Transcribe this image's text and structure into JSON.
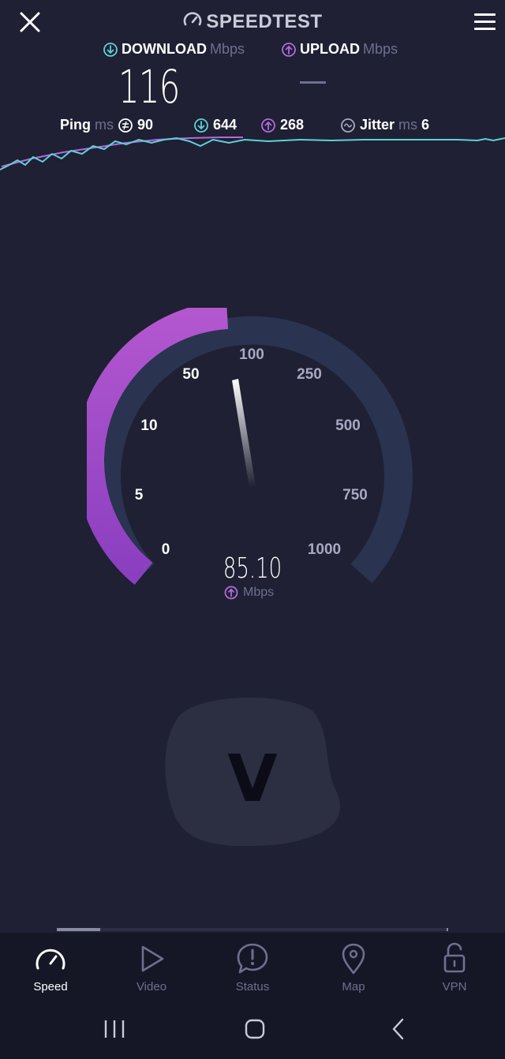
{
  "header": {
    "title": "SPEEDTEST"
  },
  "download": {
    "label": "DOWNLOAD",
    "unit": "Mbps",
    "value": "116"
  },
  "upload": {
    "label": "UPLOAD",
    "unit": "Mbps",
    "value": "—"
  },
  "stats": {
    "ping_label": "Ping",
    "ping_unit": "ms",
    "ping_value": "90",
    "download_latency": "644",
    "upload_latency": "268",
    "jitter_label": "Jitter",
    "jitter_unit": "ms",
    "jitter_value": "6"
  },
  "gauge": {
    "ticks": [
      "0",
      "5",
      "10",
      "50",
      "100",
      "250",
      "500",
      "750",
      "1000"
    ],
    "current_value": "85.10",
    "current_unit": "Mbps",
    "fill_fraction": 0.5
  },
  "badge": {
    "letter": "V"
  },
  "progress": {
    "fraction": 0.11
  },
  "tabs": [
    {
      "label": "Speed",
      "icon": "speedometer-icon",
      "active": true
    },
    {
      "label": "Video",
      "icon": "play-icon",
      "active": false
    },
    {
      "label": "Status",
      "icon": "alert-icon",
      "active": false
    },
    {
      "label": "Map",
      "icon": "map-pin-icon",
      "active": false
    },
    {
      "label": "VPN",
      "icon": "unlock-icon",
      "active": false
    }
  ],
  "colors": {
    "background": "#1f2033",
    "download_accent": "#5fd0d8",
    "upload_accent": "#b06bdc",
    "gauge_track": "#2a3350"
  }
}
